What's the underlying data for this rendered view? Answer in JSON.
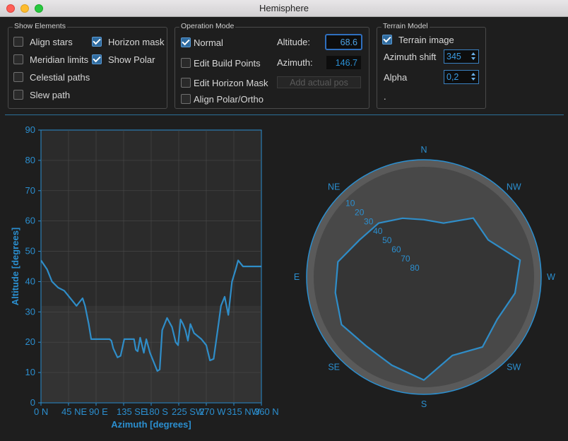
{
  "window": {
    "title": "Hemisphere"
  },
  "show_elements": {
    "title": "Show Elements",
    "items": [
      {
        "label": "Align stars",
        "checked": false
      },
      {
        "label": "Horizon mask",
        "checked": true
      },
      {
        "label": "Meridian limits",
        "checked": false
      },
      {
        "label": "Show Polar",
        "checked": true
      },
      {
        "label": "Celestial paths",
        "checked": false
      },
      {
        "label": "Slew path",
        "checked": false
      }
    ]
  },
  "operation_mode": {
    "title": "Operation Mode",
    "items": [
      {
        "label": "Normal",
        "checked": true
      },
      {
        "label": "Edit Build Points",
        "checked": false
      },
      {
        "label": "Edit Horizon Mask",
        "checked": false
      },
      {
        "label": "Align Polar/Ortho",
        "checked": false
      }
    ],
    "altitude_label": "Altitude:",
    "altitude_value": "68.6",
    "azimuth_label": "Azimuth:",
    "azimuth_value": "146.7",
    "add_actual_pos": "Add actual pos"
  },
  "terrain_model": {
    "title": "Terrain Model",
    "terrain_image_label": "Terrain image",
    "terrain_image_checked": true,
    "azimuth_shift_label": "Azimuth shift",
    "azimuth_shift_value": "345",
    "alpha_label": "Alpha",
    "alpha_value": "0,2",
    "dot": "."
  },
  "colors": {
    "accent": "#2b8fd0",
    "horizon": "#2f8dc8",
    "plot_bg": "#2b2b2b"
  },
  "chart_data": [
    {
      "type": "line",
      "xlabel": "Azimuth [degrees]",
      "ylabel": "Altitude [degrees]",
      "xlim": [
        0,
        360
      ],
      "ylim": [
        0,
        90
      ],
      "grid": true,
      "x_ticks": [
        {
          "value": 0,
          "label": "0 N"
        },
        {
          "value": 45,
          "label": "45 NE"
        },
        {
          "value": 90,
          "label": "90 E"
        },
        {
          "value": 135,
          "label": "135 SE"
        },
        {
          "value": 180,
          "label": "180 S"
        },
        {
          "value": 225,
          "label": "225 SW"
        },
        {
          "value": 270,
          "label": "270 W"
        },
        {
          "value": 315,
          "label": "315 NW"
        },
        {
          "value": 360,
          "label": "360 N"
        }
      ],
      "y_ticks": [
        0,
        10,
        20,
        30,
        40,
        50,
        60,
        70,
        80,
        90
      ],
      "series": [
        {
          "x": [
            0,
            10,
            18,
            28,
            38,
            46,
            58,
            62,
            68,
            72,
            78,
            82,
            92,
            100,
            108,
            112,
            115,
            118,
            125,
            130,
            136,
            140,
            143,
            146,
            150,
            152,
            155,
            158,
            162,
            168,
            172,
            178,
            190,
            194,
            198,
            206,
            214,
            220,
            224,
            228,
            232,
            236,
            240,
            244,
            250,
            262,
            270,
            276,
            282,
            290,
            294,
            300,
            306,
            312,
            318,
            322,
            326,
            330,
            336,
            342,
            350,
            360
          ],
          "y": [
            47,
            44,
            40,
            38,
            37,
            35,
            32,
            33,
            34.5,
            32,
            26,
            21,
            21,
            21,
            21,
            21,
            20.5,
            18,
            15,
            15.5,
            21,
            21,
            21,
            21,
            21,
            21,
            17.5,
            17,
            21.5,
            16.5,
            21,
            16.5,
            10.5,
            11,
            24,
            28,
            25,
            20,
            19,
            27.5,
            26,
            24,
            20.5,
            26,
            23,
            21,
            19,
            14,
            14.5,
            26,
            32,
            35,
            29,
            40,
            44,
            47,
            46,
            45,
            45,
            45,
            45,
            45
          ]
        }
      ]
    },
    {
      "type": "polar",
      "compass_labels": [
        "N",
        "NE",
        "E",
        "SE",
        "S",
        "SW",
        "W",
        "NW"
      ],
      "altitude_rings": [
        10,
        20,
        30,
        40,
        50,
        60,
        70,
        80
      ],
      "horizon_series": {
        "azimuth": [
          0,
          20,
          40,
          60,
          80,
          100,
          120,
          140,
          160,
          180,
          200,
          220,
          240,
          260,
          280,
          300,
          320,
          340,
          360
        ],
        "altitude": [
          46,
          42,
          36,
          33,
          23,
          21,
          17,
          21,
          18,
          11,
          26,
          20,
          25,
          19,
          15,
          33,
          31,
          46,
          46
        ]
      }
    }
  ]
}
